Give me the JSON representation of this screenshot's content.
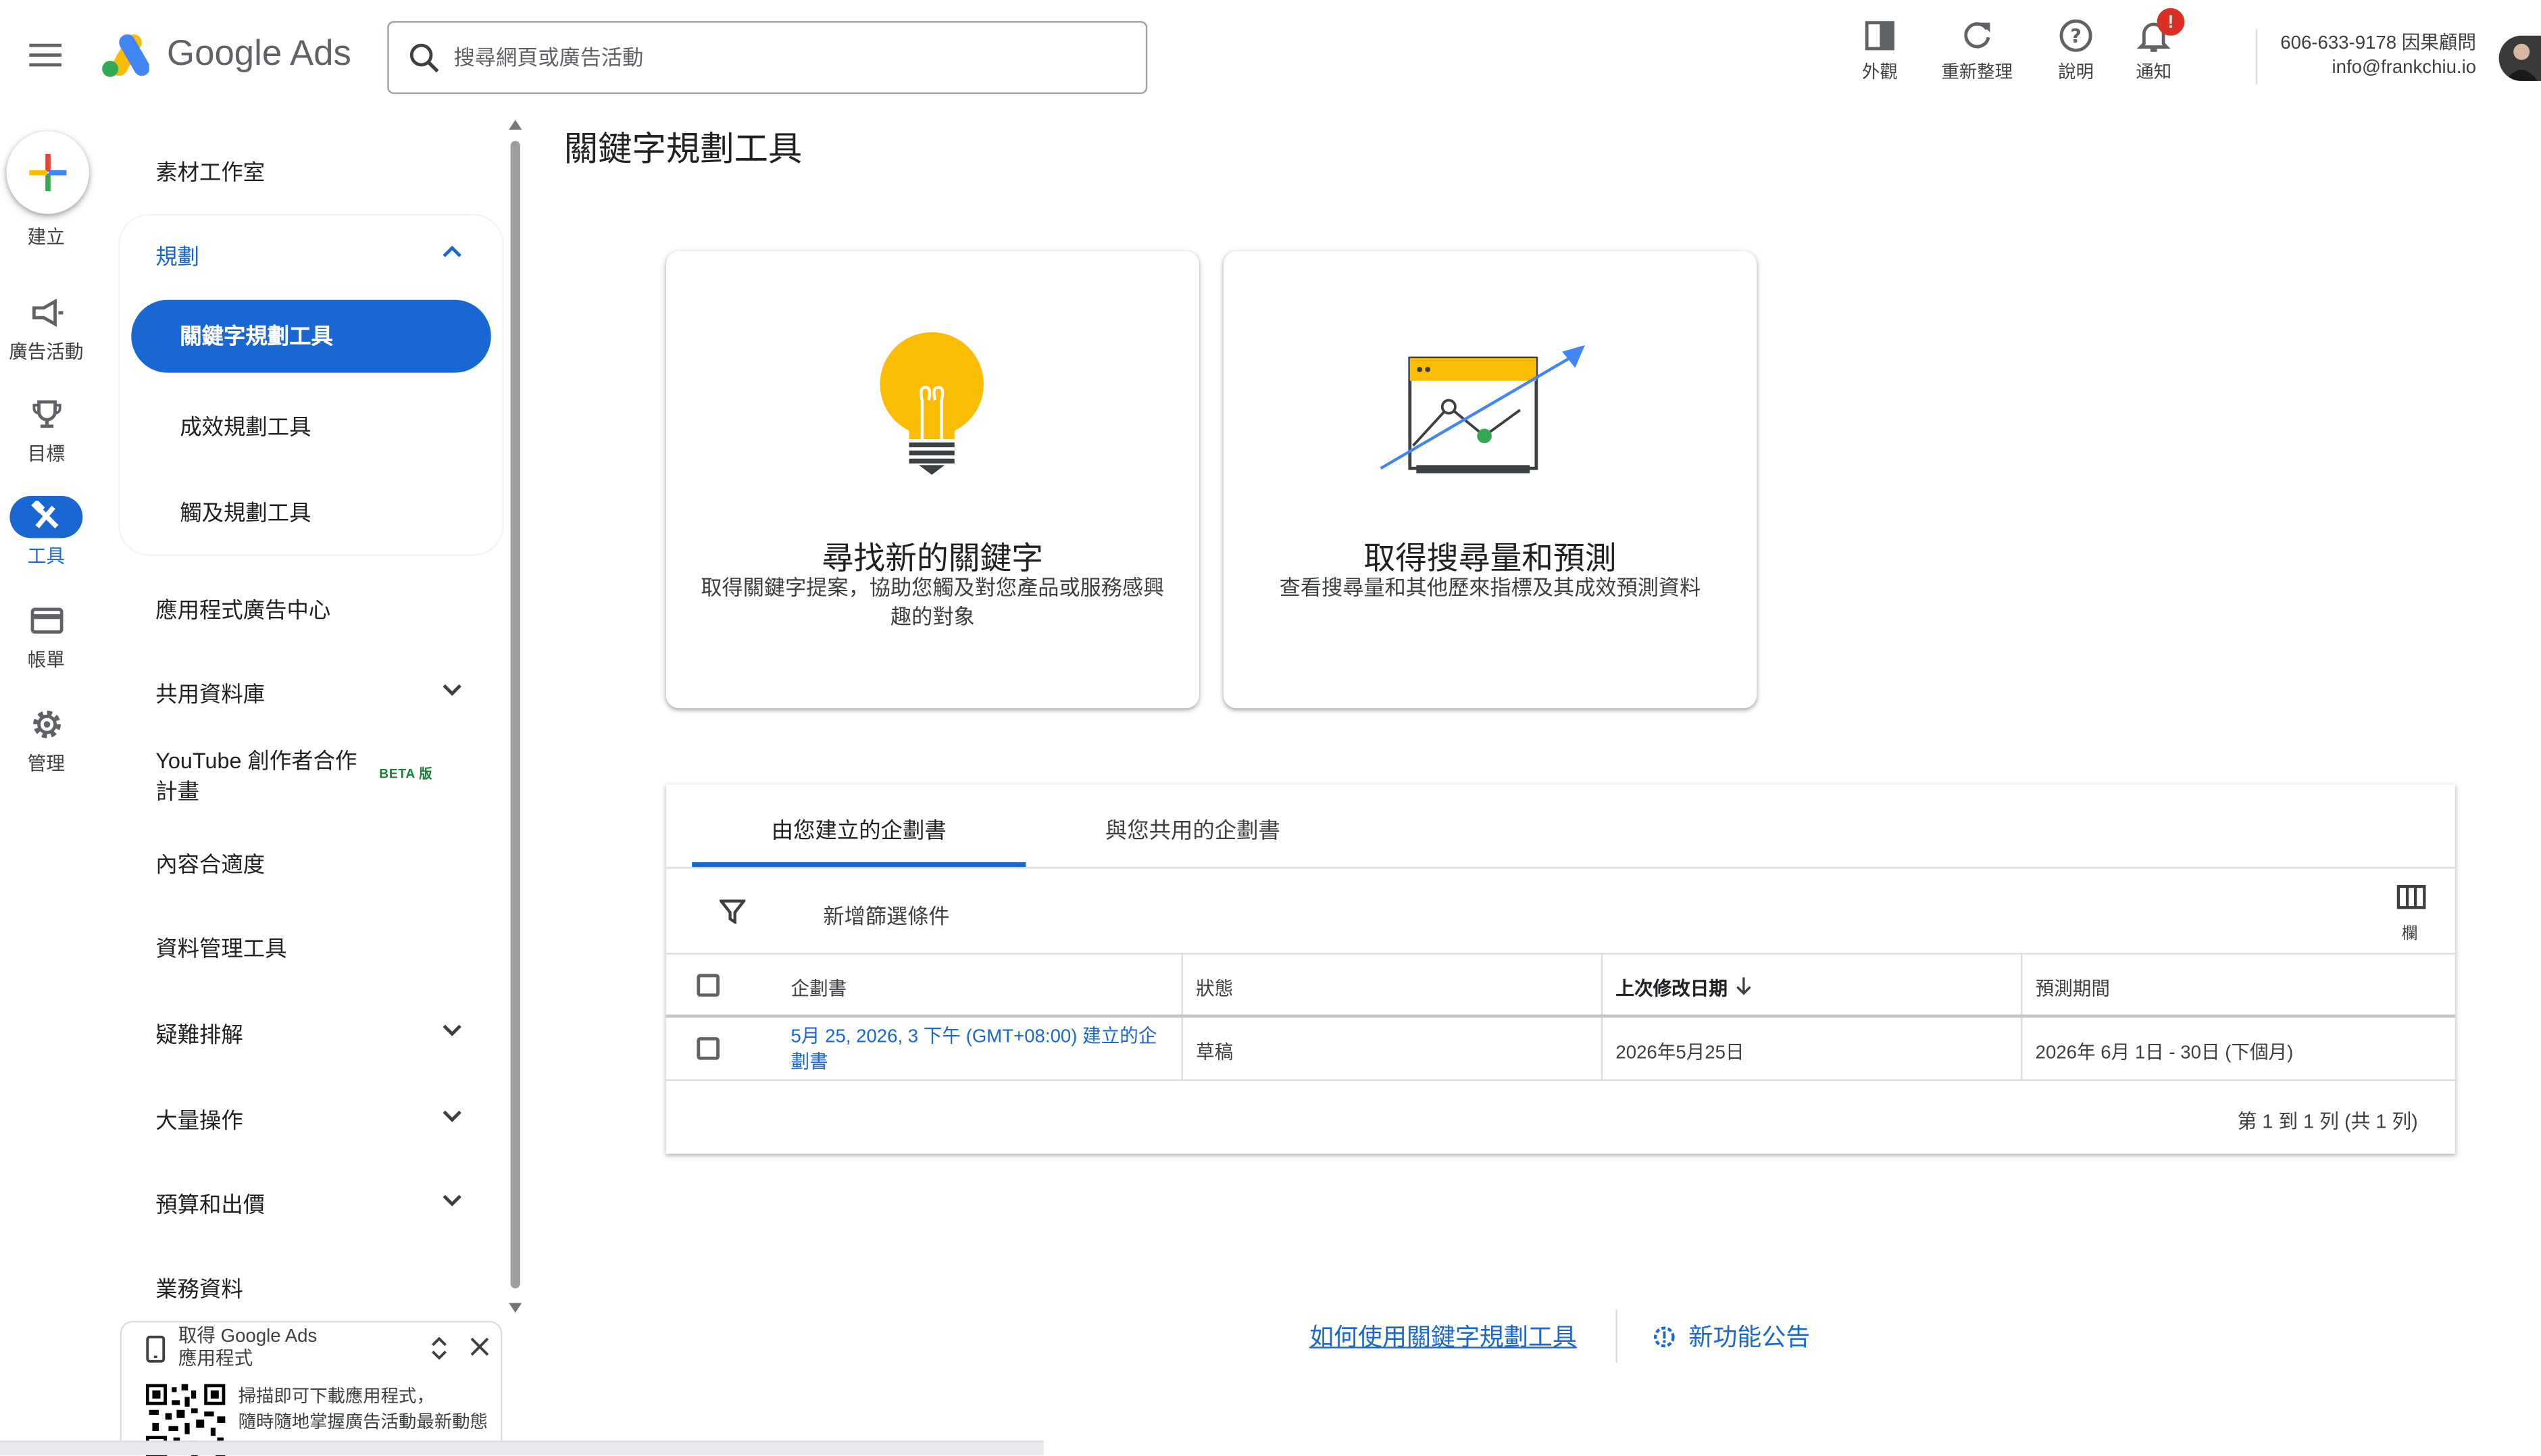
{
  "app": {
    "logo_text": "Google Ads"
  },
  "search": {
    "placeholder": "搜尋網頁或廣告活動"
  },
  "topbar": {
    "appearance": "外觀",
    "refresh": "重新整理",
    "help": "說明",
    "notifications": "通知",
    "notification_badge": "!",
    "account_line1": "606-633-9178 因果顧問",
    "account_line2": "info@frankchiu.io"
  },
  "rail": {
    "create": "建立",
    "campaigns": "廣告活動",
    "goals": "目標",
    "tools": "工具",
    "billing": "帳單",
    "admin": "管理",
    "active": "tools"
  },
  "nav": {
    "asset_studio": "素材工作室",
    "planning": "規劃",
    "planning_items": [
      "關鍵字規劃工具",
      "成效規劃工具",
      "觸及規劃工具"
    ],
    "app_ads_hub": "應用程式廣告中心",
    "shared_library": "共用資料庫",
    "youtube_line1": "YouTube 創作者合作",
    "youtube_line2": "計畫",
    "beta": "BETA 版",
    "content_suitability": "內容合適度",
    "data_manager": "資料管理工具",
    "troubleshooting": "疑難排解",
    "bulk_actions": "大量操作",
    "budgets_bidding": "預算和出價",
    "business_data": "業務資料"
  },
  "promo": {
    "title_line1": "取得 Google Ads",
    "title_line2": "應用程式",
    "text_line1": "掃描即可下載應用程式，",
    "text_line2": "隨時隨地掌握廣告活動最新動態"
  },
  "main": {
    "title": "關鍵字規劃工具",
    "cards": [
      {
        "title": "尋找新的關鍵字",
        "desc": "取得關鍵字提案，協助您觸及對您產品或服務感興趣的對象"
      },
      {
        "title": "取得搜尋量和預測",
        "desc": "查看搜尋量和其他歷來指標及其成效預測資料"
      }
    ]
  },
  "plans": {
    "tabs": [
      "由您建立的企劃書",
      "與您共用的企劃書"
    ],
    "active_tab": 0,
    "add_filter": "新增篩選條件",
    "columns_label": "欄",
    "headers": [
      "企劃書",
      "狀態",
      "上次修改日期",
      "預測期間"
    ],
    "sort_column": "上次修改日期",
    "rows": [
      {
        "plan_line1": "5月 25, 2026, 3 下午 (GMT+08:00) 建立的企",
        "plan_line2": "劃書",
        "status": "草稿",
        "modified": "2026年5月25日",
        "period": "2026年 6月 1日 - 30日 (下個月)"
      }
    ],
    "pagination": "第 1 到 1 列 (共 1 列)"
  },
  "footer": {
    "how_to": "如何使用關鍵字規劃工具",
    "announcements": "新功能公告"
  },
  "colors": {
    "accent": "#1967d2",
    "alert": "#d93025",
    "bulb": "#fbbc04"
  }
}
